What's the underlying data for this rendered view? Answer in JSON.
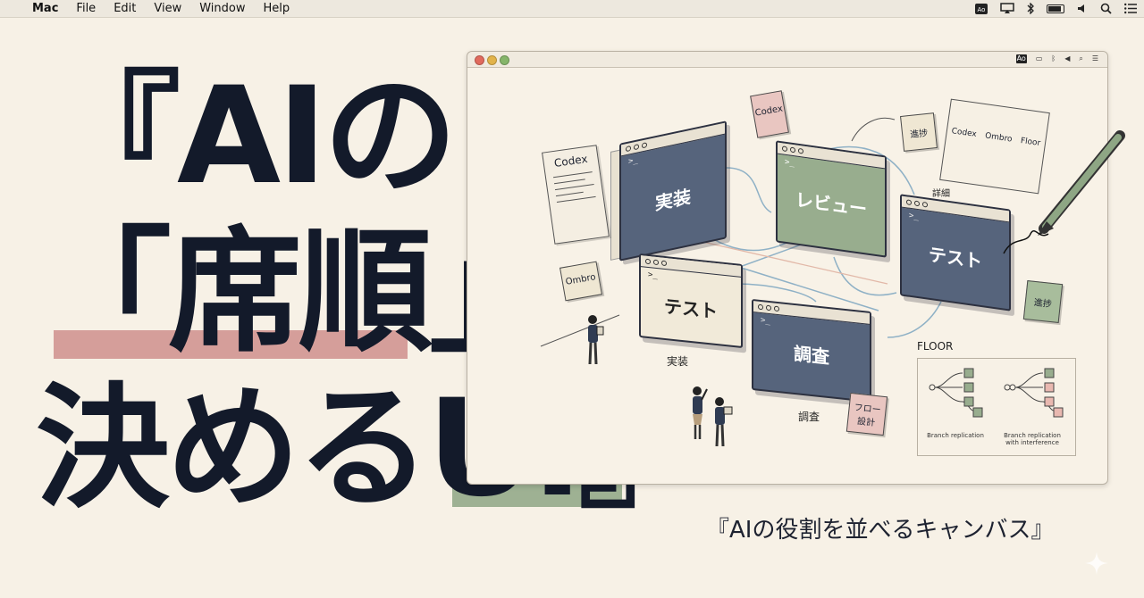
{
  "menubar": {
    "apple": "",
    "app_name": "Mac",
    "items": [
      "File",
      "Edit",
      "View",
      "Window",
      "Help"
    ],
    "status_icons": [
      "ao-input-icon",
      "airplay-icon",
      "bluetooth-icon",
      "battery-icon",
      "volume-icon",
      "search-icon",
      "control-center-icon"
    ],
    "input_label": "Ao"
  },
  "headline": {
    "line1": "『AIの",
    "line2": "「席順」を",
    "line3_text": "決める",
    "line3_ui": "UI",
    "line3_close": "』",
    "highlight_color_red": "#cf8f8c",
    "highlight_color_green": "#8ea684"
  },
  "subtitle": "『AIの役割を並べるキャンバス』",
  "window": {
    "status_label": "Ao",
    "panels": {
      "impl": {
        "prompt": ">_",
        "label": "実装"
      },
      "review": {
        "prompt": ">_",
        "label": "レビュー"
      },
      "test_right": {
        "prompt": ">_",
        "label": "テスト"
      },
      "test_center": {
        "prompt": ">_",
        "label": "テスト"
      },
      "research": {
        "prompt": ">_",
        "label": "調査"
      }
    },
    "notes": {
      "codex_top": "Codex",
      "progress_top": "進捗",
      "ombro": "Ombro",
      "progress_right": "進捗",
      "flow_design": "フロー\n設計"
    },
    "doc_title": "Codex",
    "flow_card": {
      "items": [
        "Codex",
        "Ombro",
        "Floor"
      ]
    },
    "detail_label": "詳細",
    "captions": {
      "impl": "実装",
      "research": "調査"
    },
    "floor": {
      "title": "FLOOR",
      "caption_left": "Branch replication",
      "caption_right": "Branch replication\nwith interference"
    }
  },
  "colors": {
    "background": "#f7f1e6",
    "navy": "#56647c",
    "green": "#98ad8e",
    "pink": "#e9c6c1",
    "text": "#131a2a"
  }
}
